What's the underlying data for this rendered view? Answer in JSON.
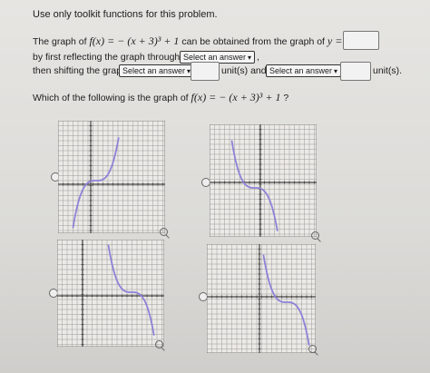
{
  "instruction": "Use only toolkit functions for this problem.",
  "statement": {
    "prefix": "The graph of",
    "function": "f(x) = − (x + 3)³ + 1",
    "mid": "can be obtained from the graph of",
    "target": "y ="
  },
  "line2": {
    "text": "by first reflecting the graph through the",
    "select": "Select an answer",
    "tail": ","
  },
  "line3": {
    "text": "then shifting the graph",
    "select1": "Select an answer",
    "units1": "unit(s) and",
    "select2": "Select an answer",
    "units2": "unit(s)."
  },
  "question": {
    "prefix": "Which of the following is the graph of",
    "function": "f(x) = − (x + 3)³ + 1",
    "suffix": "?"
  },
  "options": [
    {
      "label": "option-a",
      "curve": "increasing"
    },
    {
      "label": "option-b",
      "curve": "decreasing"
    },
    {
      "label": "option-c",
      "curve": "decreasing"
    },
    {
      "label": "option-d",
      "curve": "decreasing"
    }
  ],
  "colors": {
    "curve": "#8d82d8",
    "grid": "#9a9a9a",
    "axis": "#444444"
  },
  "icons": {
    "magnify": "magnify-icon",
    "dropdown": "chevron-down-icon"
  }
}
